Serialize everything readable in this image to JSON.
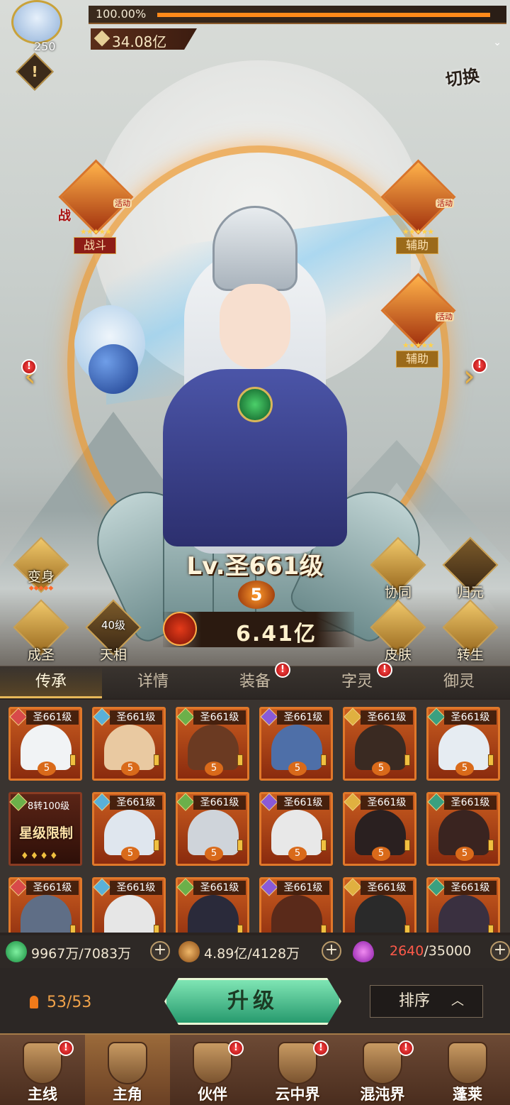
{
  "topbar": {
    "player_level": "250",
    "exp_percent": "100.00%",
    "exp_fraction": 1.0,
    "power": "34.08亿",
    "alert_symbol": "!"
  },
  "switch_label": "切换",
  "pets": [
    {
      "role": "战斗",
      "tag": "活动",
      "badge": "战",
      "stars": "★★★★★"
    },
    {
      "role": "辅助",
      "tag": "活动",
      "badge": "",
      "stars": "★★★★★"
    },
    {
      "role": "辅助",
      "tag": "活动",
      "badge": "",
      "stars": "★★★★★"
    }
  ],
  "hero": {
    "level_text": "Lv.圣661级",
    "star": "5",
    "combat_power": "6.41亿"
  },
  "left_skills": [
    {
      "label": "变身",
      "sub": ""
    },
    {
      "label": "成圣",
      "sub": ""
    },
    {
      "label": "天相",
      "sub": "40级"
    }
  ],
  "right_skills": [
    {
      "label": "协同"
    },
    {
      "label": "归元"
    },
    {
      "label": "皮肤"
    },
    {
      "label": "转生"
    }
  ],
  "tabs": [
    {
      "label": "传承",
      "active": true,
      "alert": false
    },
    {
      "label": "详情",
      "active": false,
      "alert": false
    },
    {
      "label": "装备",
      "active": false,
      "alert": true
    },
    {
      "label": "字灵",
      "active": false,
      "alert": true
    },
    {
      "label": "御灵",
      "active": false,
      "alert": false
    }
  ],
  "cards": [
    {
      "level": "圣661级",
      "star": "5",
      "color": "#f1f3f5"
    },
    {
      "level": "圣661级",
      "star": "5",
      "color": "#e9c9a1"
    },
    {
      "level": "圣661级",
      "star": "5",
      "color": "#6b3a22"
    },
    {
      "level": "圣661级",
      "star": "5",
      "color": "#4e6fa8"
    },
    {
      "level": "圣661级",
      "star": "5",
      "color": "#3a2a22"
    },
    {
      "level": "圣661级",
      "star": "5",
      "color": "#e6ecf2"
    },
    {
      "special": true,
      "level": "8转100级",
      "limit": "星级限制"
    },
    {
      "level": "圣661级",
      "star": "5",
      "color": "#dfe6ee"
    },
    {
      "level": "圣661级",
      "star": "5",
      "color": "#cfd4da"
    },
    {
      "level": "圣661级",
      "star": "5",
      "color": "#e8e8e8"
    },
    {
      "level": "圣661级",
      "star": "5",
      "color": "#2a2020"
    },
    {
      "level": "圣661级",
      "star": "5",
      "color": "#3a2420"
    },
    {
      "level": "圣661级",
      "star": "",
      "color": "#5f6e86"
    },
    {
      "level": "圣661级",
      "star": "",
      "color": "#e6e6e6"
    },
    {
      "level": "圣661级",
      "star": "",
      "color": "#2a2a3a"
    },
    {
      "level": "圣661级",
      "star": "",
      "color": "#5a2a1a"
    },
    {
      "level": "圣661级",
      "star": "",
      "color": "#2a2a2a"
    },
    {
      "level": "圣661级",
      "star": "",
      "color": "#3a3040"
    }
  ],
  "resources": {
    "jade": {
      "current": "9967万",
      "sep": "/",
      "required": "7083万",
      "color": "#3cc46a"
    },
    "coin": {
      "current": "4.89亿",
      "sep": "/",
      "required": "4128万",
      "color": "#c98a3a"
    },
    "crystal": {
      "current": "2640",
      "sep": "/",
      "required": "35000",
      "color": "#c04ad8"
    }
  },
  "actions": {
    "count": "53/53",
    "upgrade_label": "升级",
    "sort_label": "排序",
    "sort_arrow": "︿"
  },
  "bottom_nav": [
    {
      "label": "主线",
      "alert": true,
      "active": false
    },
    {
      "label": "主角",
      "alert": false,
      "active": true
    },
    {
      "label": "伙伴",
      "alert": true,
      "active": false
    },
    {
      "label": "云中界",
      "alert": true,
      "active": false
    },
    {
      "label": "混沌界",
      "alert": true,
      "active": false
    },
    {
      "label": "蓬莱",
      "alert": false,
      "active": false
    }
  ],
  "alert_symbol": "!"
}
